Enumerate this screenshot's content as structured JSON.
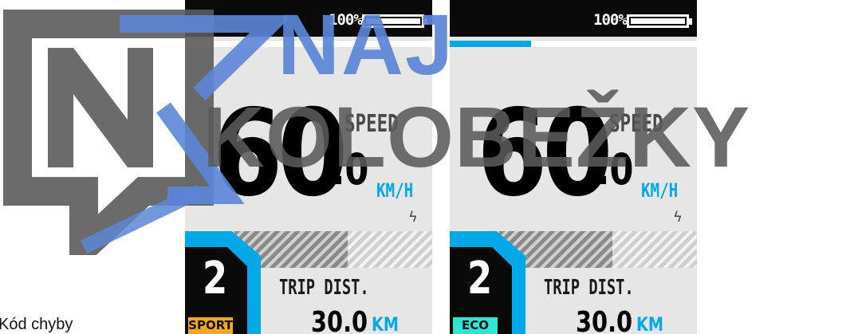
{
  "panels": [
    {
      "battery": "100%",
      "speed_int": "60",
      "speed_dec": ".0",
      "speed_label": "SPEED",
      "speed_unit": "KM/H",
      "assist_level": "2",
      "mode": "SPORT",
      "trip_label": "TRIP DIST.",
      "trip_value": "30.0",
      "trip_unit": "KM",
      "progress": 0,
      "mode_color": "#f5a623"
    },
    {
      "battery": "100%",
      "speed_int": "60",
      "speed_dec": ".0",
      "speed_label": "SPEED",
      "speed_unit": "KM/H",
      "assist_level": "2",
      "mode": "ECO",
      "trip_label": "TRIP DIST.",
      "trip_value": "30.0",
      "trip_unit": "KM",
      "progress": 0.33,
      "mode_color": "#2ee6d6"
    }
  ],
  "watermark": {
    "line1": "NAJ",
    "line2": "KOLOBEŽKY",
    "monogram": "NK",
    "colors": {
      "blue": "#5b86d6",
      "gray": "#5b5b5b"
    }
  },
  "caption": "Kód chyby",
  "accent_color": "#00a8e8",
  "icons": [
    "battery-icon",
    "bolt-icon",
    "nk-logo"
  ]
}
